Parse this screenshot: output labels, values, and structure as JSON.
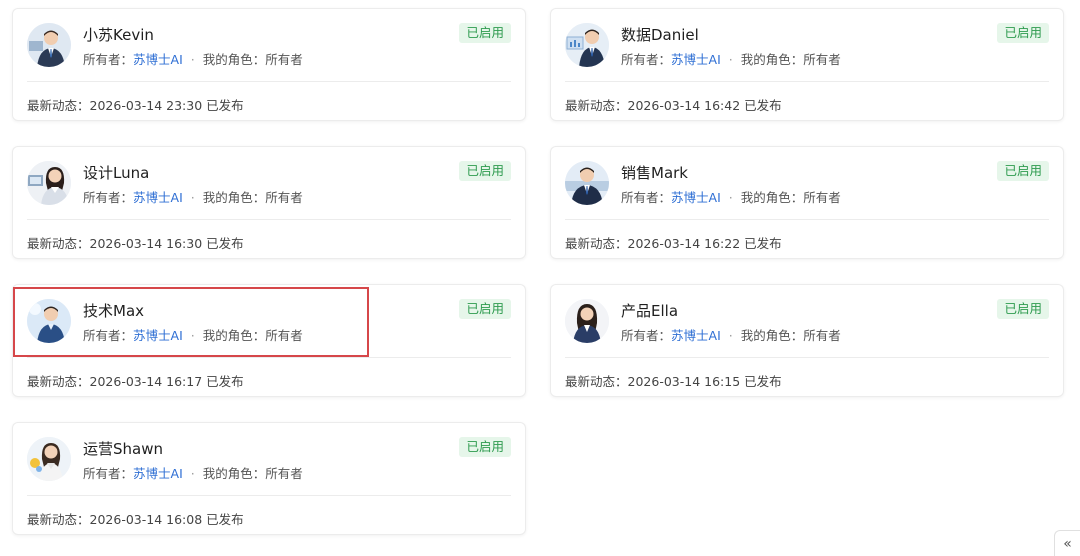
{
  "cards": [
    {
      "name": "小苏Kevin",
      "owner_label": "所有者：",
      "owner": "苏博士AI",
      "role_label": "我的角色：",
      "role": "所有者",
      "status": "已启用",
      "activity_label": "最新动态：",
      "activity": "2026-03-14 23:30 已发布"
    },
    {
      "name": "数据Daniel",
      "owner_label": "所有者：",
      "owner": "苏博士AI",
      "role_label": "我的角色：",
      "role": "所有者",
      "status": "已启用",
      "activity_label": "最新动态：",
      "activity": "2026-03-14 16:42 已发布"
    },
    {
      "name": "设计Luna",
      "owner_label": "所有者：",
      "owner": "苏博士AI",
      "role_label": "我的角色：",
      "role": "所有者",
      "status": "已启用",
      "activity_label": "最新动态：",
      "activity": "2026-03-14 16:30 已发布"
    },
    {
      "name": "销售Mark",
      "owner_label": "所有者：",
      "owner": "苏博士AI",
      "role_label": "我的角色：",
      "role": "所有者",
      "status": "已启用",
      "activity_label": "最新动态：",
      "activity": "2026-03-14 16:22 已发布"
    },
    {
      "name": "技术Max",
      "owner_label": "所有者：",
      "owner": "苏博士AI",
      "role_label": "我的角色：",
      "role": "所有者",
      "status": "已启用",
      "activity_label": "最新动态：",
      "activity": "2026-03-14 16:17 已发布"
    },
    {
      "name": "产品Ella",
      "owner_label": "所有者：",
      "owner": "苏博士AI",
      "role_label": "我的角色：",
      "role": "所有者",
      "status": "已启用",
      "activity_label": "最新动态：",
      "activity": "2026-03-14 16:15 已发布"
    },
    {
      "name": "运营Shawn",
      "owner_label": "所有者：",
      "owner": "苏博士AI",
      "role_label": "我的角色：",
      "role": "所有者",
      "status": "已启用",
      "activity_label": "最新动态：",
      "activity": "2026-03-14 16:08 已发布"
    }
  ],
  "colors": {
    "badge_text": "#2e9b4f",
    "badge_bg": "#e6f6ea",
    "link": "#2f6fd4",
    "highlight": "#d6474a"
  },
  "collapse_button": {
    "icon": "double-chevron-left-icon",
    "glyph": "«"
  }
}
